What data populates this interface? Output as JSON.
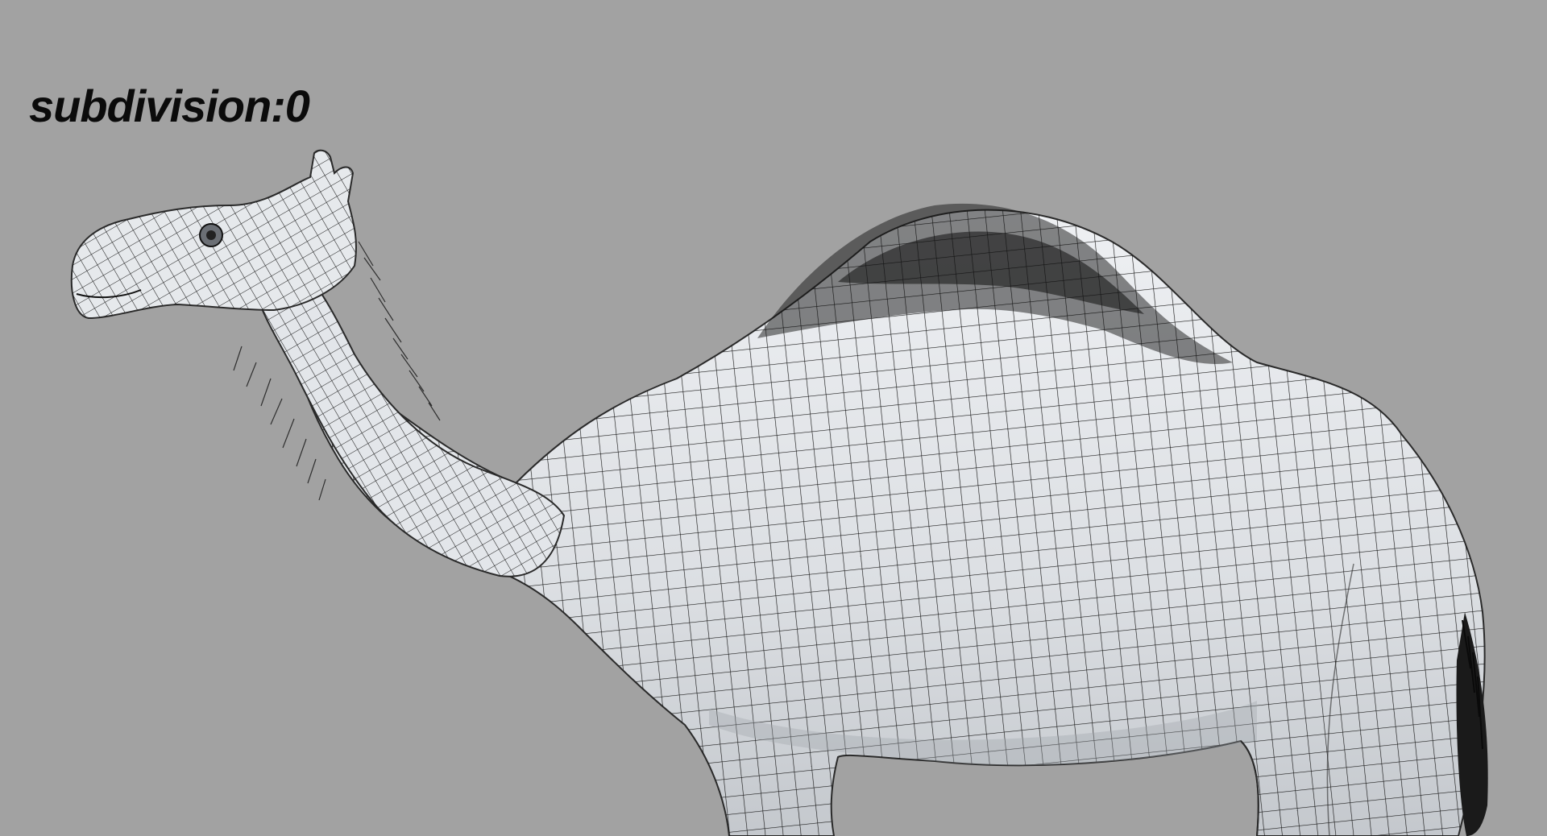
{
  "viewport": {
    "overlay_text": "subdivision:0",
    "background_color": "#a2a2a2",
    "mesh_fill_color": "#dfe2e6",
    "wire_color": "#1a1a1a",
    "fur_color": "#121212",
    "model_subject": "camel-wireframe-mesh"
  }
}
